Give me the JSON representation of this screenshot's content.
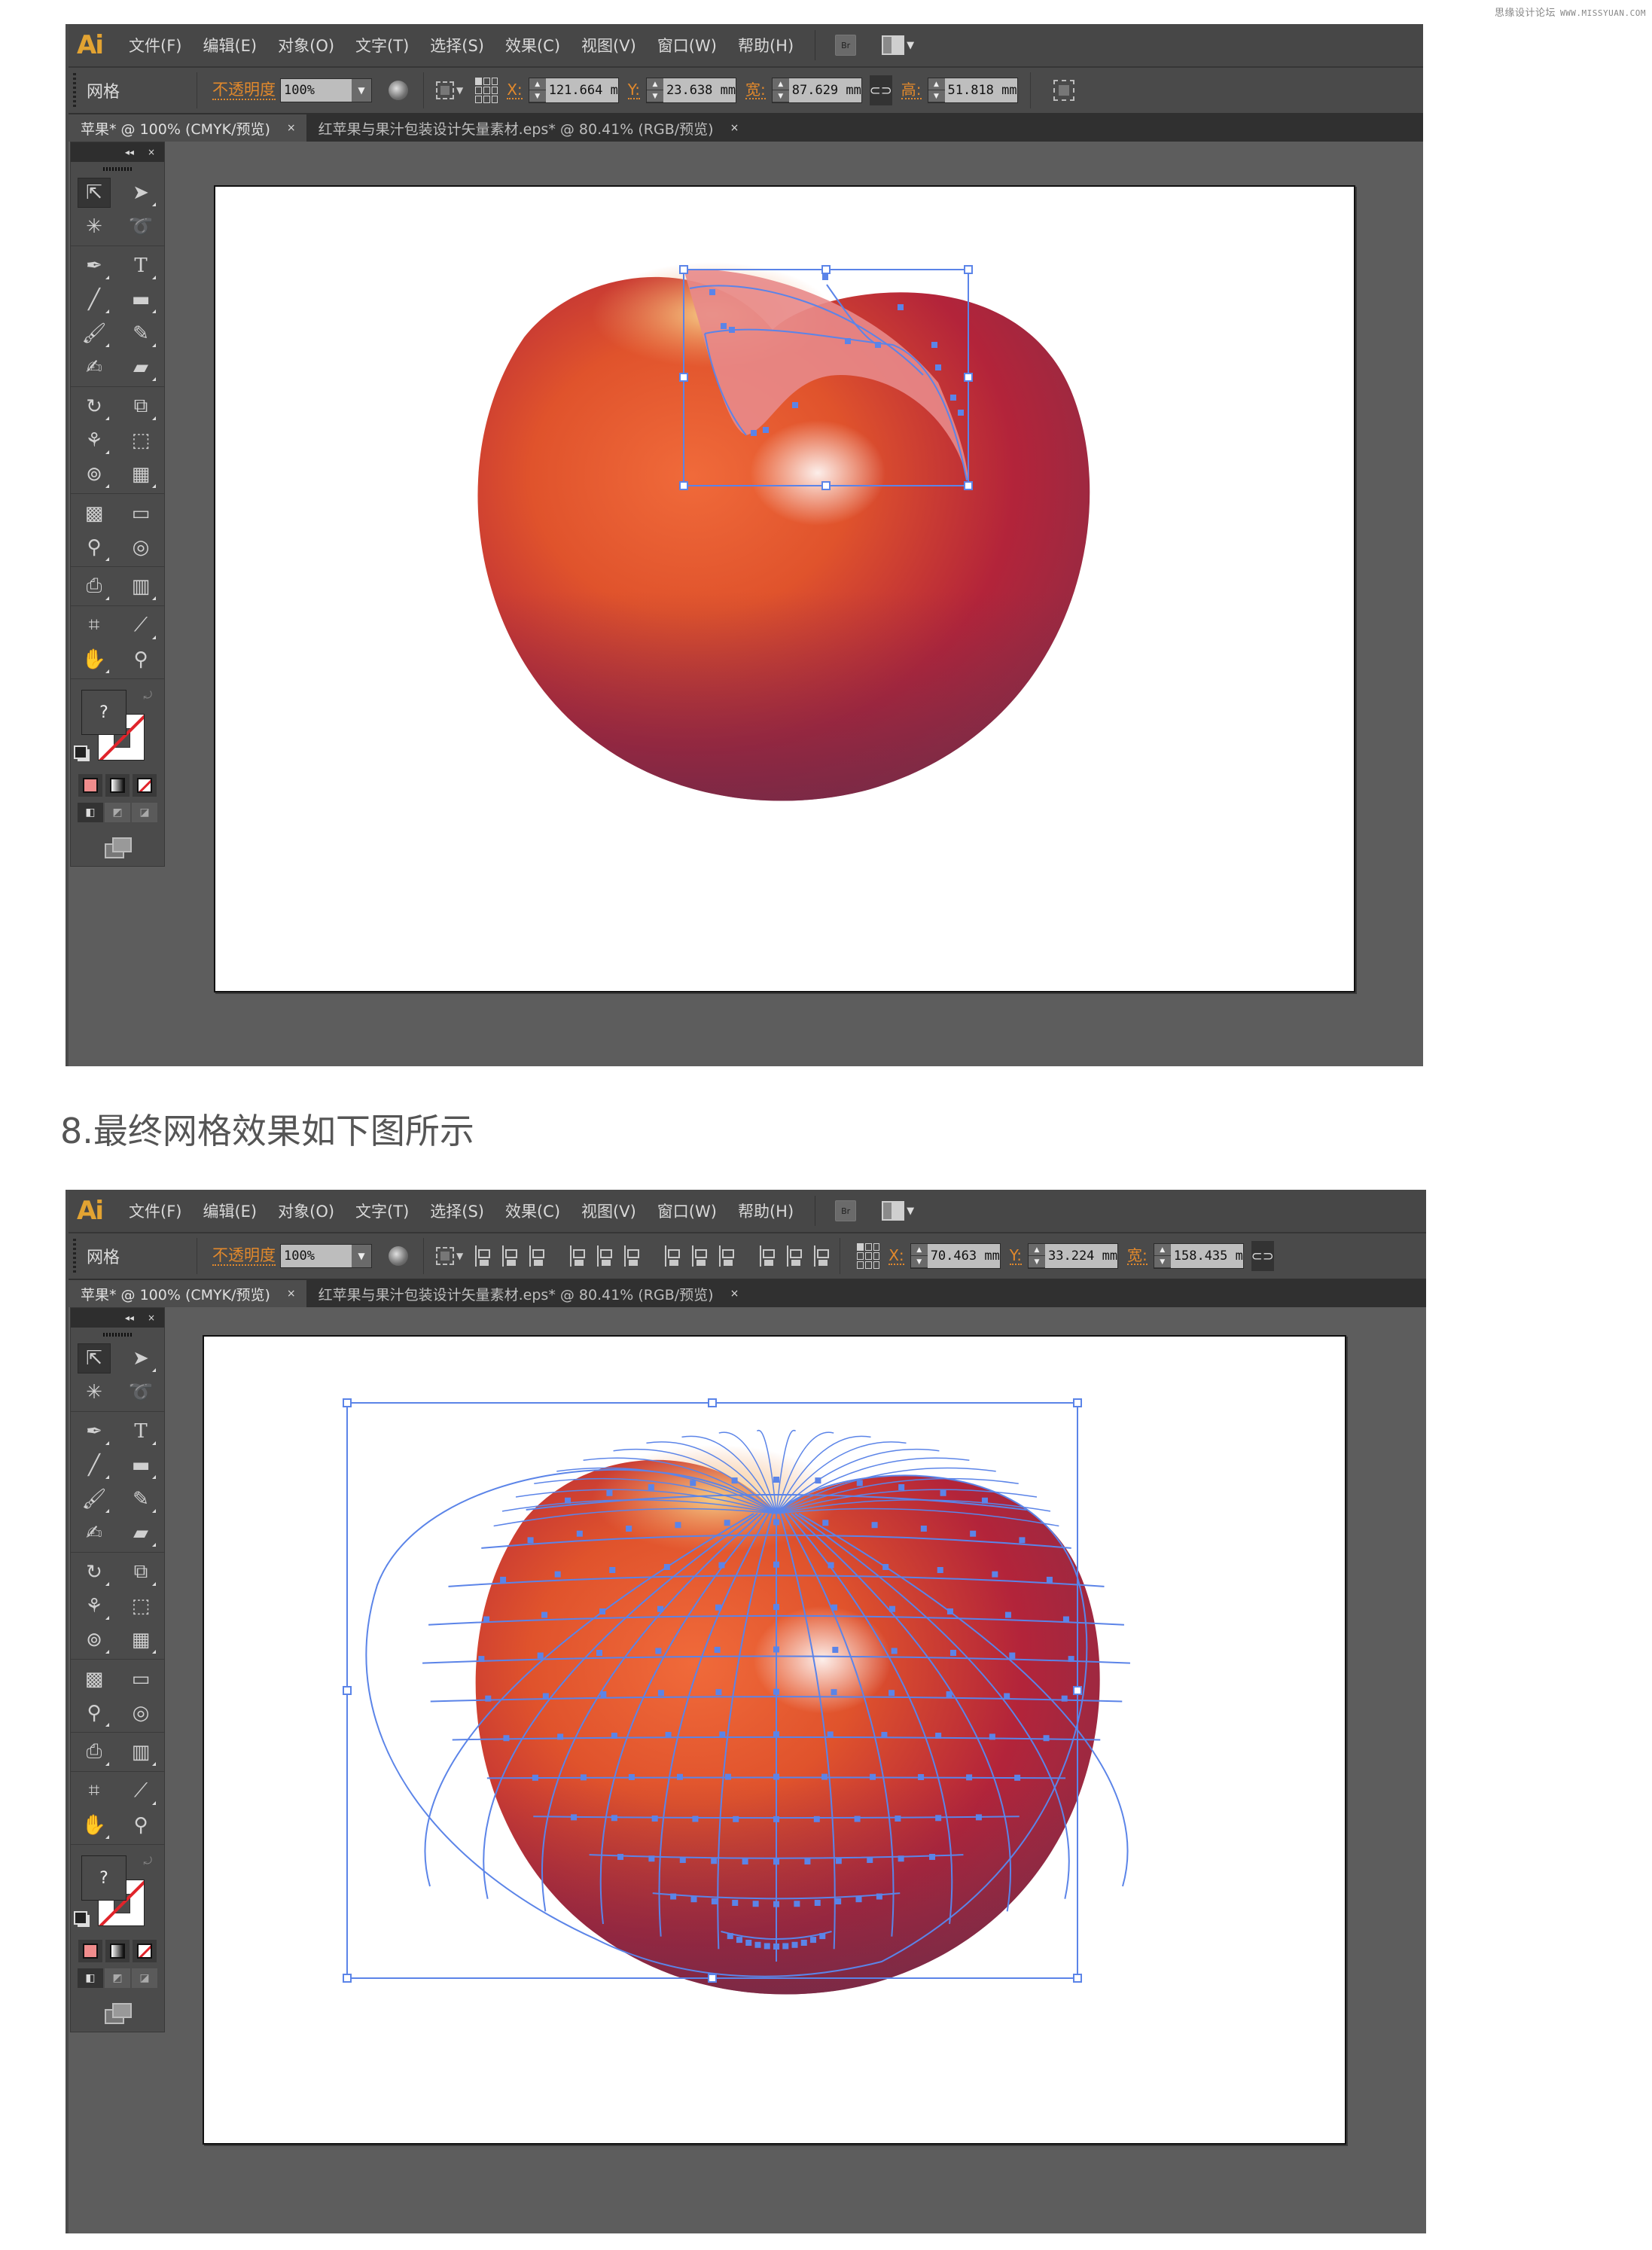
{
  "watermark": {
    "name": "思缘设计论坛",
    "site": "WWW.MISSYUAN.COM"
  },
  "heading": "8.最终网格效果如下图所示",
  "app": {
    "logo": "Ai",
    "menu": [
      "文件(F)",
      "编辑(E)",
      "对象(O)",
      "文字(T)",
      "选择(S)",
      "效果(C)",
      "视图(V)",
      "窗口(W)",
      "帮助(H)"
    ],
    "bridge_label": "Br",
    "tabs": [
      {
        "label": "苹果* @ 100% (CMYK/预览)",
        "active": true,
        "close": "×"
      },
      {
        "label": "红苹果与果汁包装设计矢量素材.eps* @ 80.41% (RGB/预览)",
        "active": false,
        "close": "×"
      }
    ],
    "tools_panel": {
      "collapse": "◂◂",
      "close": "×",
      "fill_unknown": "?"
    }
  },
  "screenshots": [
    {
      "control": {
        "object_type": "网格",
        "opacity_label": "不透明度",
        "opacity_value": "100%",
        "x_label": "X:",
        "x_value": "121.664 m",
        "y_label": "Y:",
        "y_value": "23.638 mm",
        "w_label": "宽:",
        "w_value": "87.629 mm",
        "h_label": "高:",
        "h_value": "51.818 mm"
      },
      "canvas": {
        "description": "apple with partial mesh selection on top-right",
        "selection": "partial-mesh"
      }
    },
    {
      "control": {
        "object_type": "网格",
        "opacity_label": "不透明度",
        "opacity_value": "100%",
        "x_label": "X:",
        "x_value": "70.463 mm",
        "y_label": "Y:",
        "y_value": "33.224 mm",
        "w_label": "宽:",
        "w_value": "158.435 m",
        "align_icons": [
          "align-left",
          "align-h-center",
          "align-right",
          "align-top",
          "align-v-center",
          "align-bottom",
          "distribute-top",
          "distribute-v-center",
          "distribute-bottom",
          "distribute-left",
          "distribute-h-center",
          "distribute-right"
        ]
      },
      "canvas": {
        "description": "apple with full gradient mesh shown",
        "selection": "full-mesh"
      }
    }
  ],
  "colors": {
    "mesh_line": "#5b84e8",
    "accent_orange": "#e2892c",
    "ai_logo": "#e2a332",
    "apple_red": "#b3243a",
    "apple_orange": "#e0532c"
  }
}
